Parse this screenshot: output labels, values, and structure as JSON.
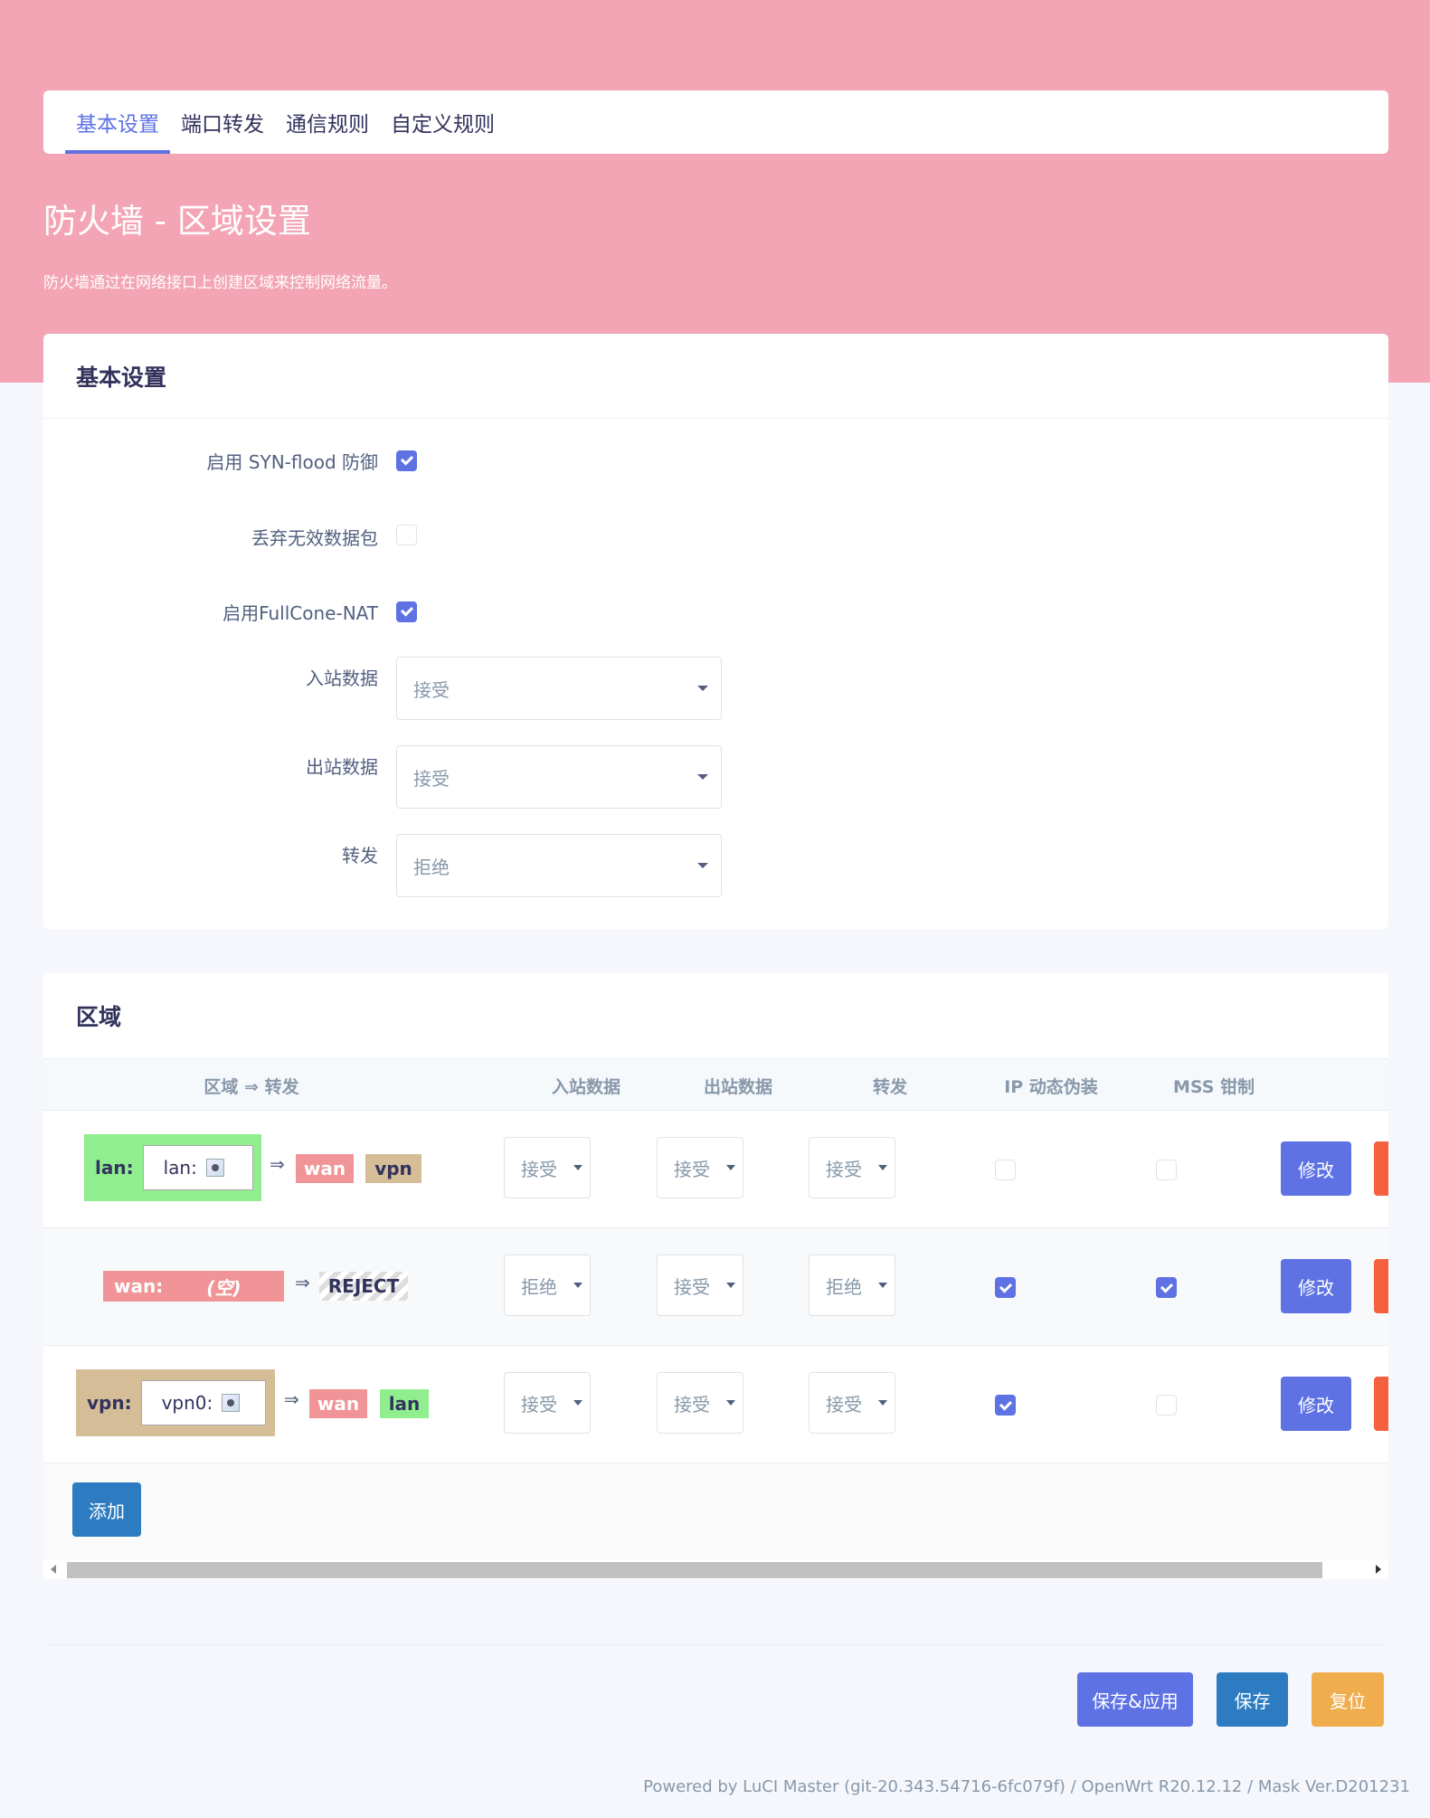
{
  "tabs": [
    "基本设置",
    "端口转发",
    "通信规则",
    "自定义规则"
  ],
  "page": {
    "title": "防火墙 - 区域设置",
    "description": "防火墙通过在网络接口上创建区域来控制网络流量。"
  },
  "basic": {
    "header": "基本设置",
    "syn_flood": {
      "label": "启用 SYN-flood 防御",
      "checked": true
    },
    "drop_invalid": {
      "label": "丢弃无效数据包",
      "checked": false
    },
    "fullcone": {
      "label": "启用FullCone-NAT",
      "checked": true
    },
    "input": {
      "label": "入站数据",
      "value": "接受"
    },
    "output": {
      "label": "出站数据",
      "value": "接受"
    },
    "forward": {
      "label": "转发",
      "value": "拒绝"
    }
  },
  "zones": {
    "header": "区域",
    "columns": [
      "区域 ⇒ 转发",
      "入站数据",
      "出站数据",
      "转发",
      "IP 动态伪装",
      "MSS 钳制"
    ],
    "arrow": "⇒",
    "rows": [
      {
        "name": "lan:",
        "iface": "lan:",
        "color": "#90ee8f",
        "targets": [
          "wan",
          "vpn"
        ],
        "input": "接受",
        "output": "接受",
        "forward": "接受",
        "masq": false,
        "mss": false
      },
      {
        "name": "wan:",
        "iface": "(空)",
        "color": "#f09497",
        "targets": [
          "REJECT"
        ],
        "input": "拒绝",
        "output": "接受",
        "forward": "拒绝",
        "masq": true,
        "mss": true
      },
      {
        "name": "vpn:",
        "iface": "vpn0:",
        "color": "#d5bd98",
        "targets": [
          "wan",
          "lan"
        ],
        "input": "接受",
        "output": "接受",
        "forward": "接受",
        "masq": true,
        "mss": false
      }
    ],
    "edit_label": "修改",
    "add_label": "添加"
  },
  "actions": {
    "save_apply": "保存&应用",
    "save": "保存",
    "reset": "复位"
  },
  "colors": {
    "primary": "#5e72e4",
    "info": "#2d7cc2",
    "warning": "#f0ad4e",
    "danger": "#f5603f",
    "hero": "#f3a5b6"
  },
  "footer": "Powered by LuCI Master (git-20.343.54716-6fc079f) / OpenWrt R20.12.12 / Mask Ver.D201231"
}
